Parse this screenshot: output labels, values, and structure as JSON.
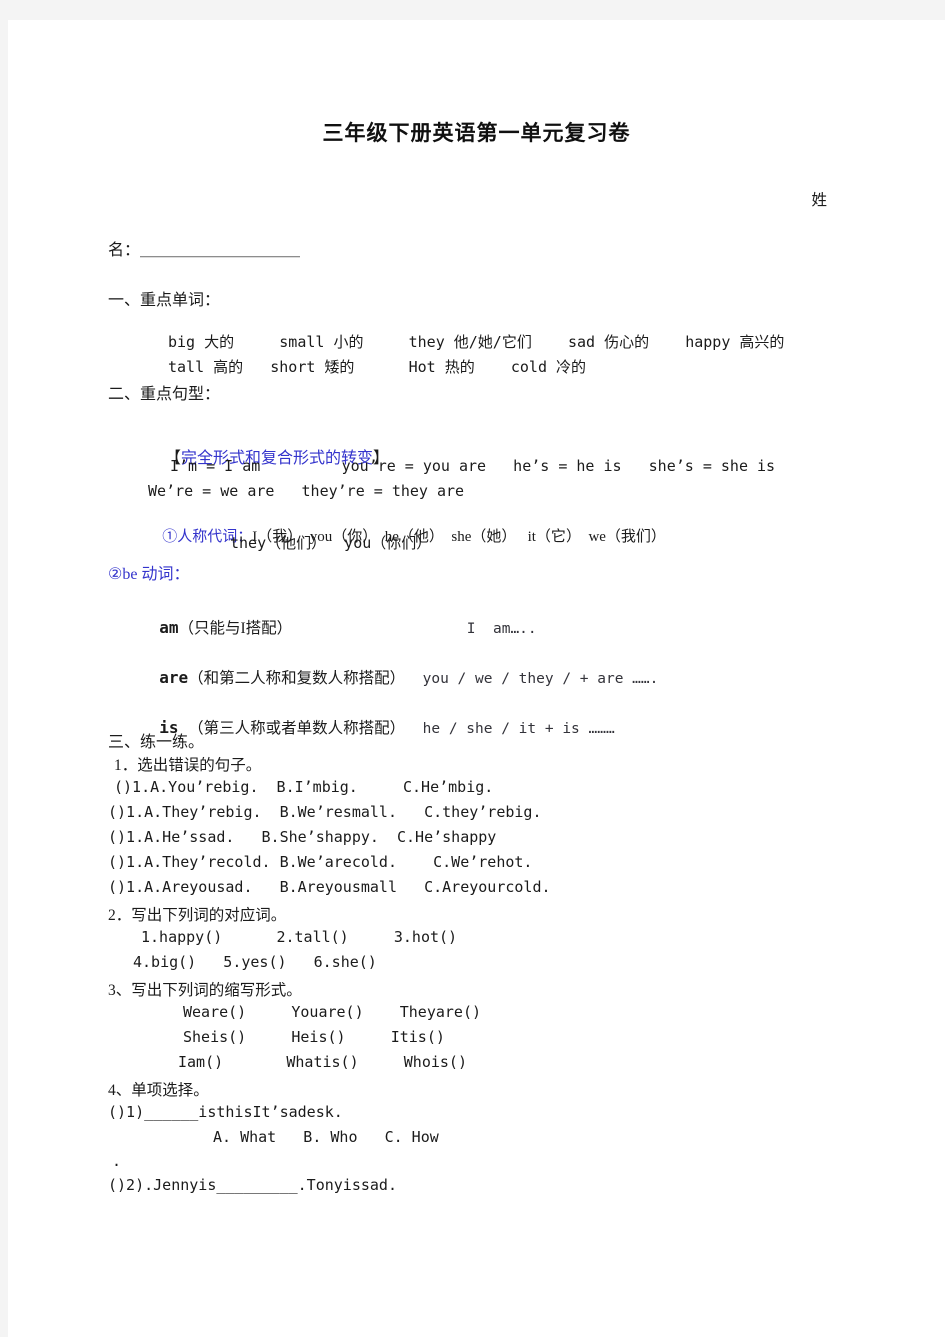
{
  "document": {
    "title": "三年级下册英语第一单元复习卷",
    "name_label_right": "姓",
    "name_label_line": "名：＿＿＿＿＿＿＿＿＿＿"
  },
  "section1": {
    "heading": "一、重点单词：",
    "row1": [
      {
        "en": "big ",
        "cn": "大的"
      },
      {
        "en": "small ",
        "cn": "小的"
      },
      {
        "en": "they ",
        "cn": "他/她/它们"
      },
      {
        "en": "sad ",
        "cn": "伤心的"
      },
      {
        "en": "happy ",
        "cn": "高兴的"
      }
    ],
    "row2": [
      {
        "en": "tall ",
        "cn": "高的"
      },
      {
        "en": "short ",
        "cn": "矮的"
      },
      {
        "en": "Hot ",
        "cn": "热的"
      },
      {
        "en": "cold ",
        "cn": "冷的"
      }
    ],
    "row1_text": "big 大的     small 小的     they 他/她/它们    sad 伤心的    happy 高兴的",
    "row2_text": "tall 高的   short 矮的      Hot 热的    cold 冷的"
  },
  "section2": {
    "heading": "二、重点句型：",
    "bracket_open": "【",
    "bracket_title": "完全形式和复合形式的转变",
    "bracket_close": "】",
    "contractions_line1": "I’m = I am         you’re = you are   he’s = he is   she’s = she is",
    "contractions_line2": "We’re = we are   they’re = they are",
    "item1_label": "①人称代词：",
    "item1_line1": "I（我）  you（你）  he（他）  she（她）   it（它）  we（我们）",
    "item1_line2": "they（他们）  you（你们）",
    "item2_label": "②be 动词：",
    "be_rows": [
      {
        "keyword": "am",
        "note": "（只能与I搭配）",
        "example": "I  am…..",
        "example_gap": "                    "
      },
      {
        "keyword": "are",
        "note": "（和第二人称和复数人称搭配）",
        "example": "you / we / they / + are …….",
        "example_gap": "  "
      },
      {
        "keyword": "is ",
        "note": "（第三人称或者单数人称搭配）",
        "example": "he / she / it + is ………",
        "example_gap": "  "
      }
    ]
  },
  "section3": {
    "heading": "三、练一练。",
    "q1_title": "1．选出错误的句子。",
    "q1_items": [
      "()1.A.You’rebig.  B.I’mbig.     C.He’mbig.",
      "()1.A.They’rebig.  B.We’resmall.   C.they’rebig.",
      "()1.A.He’ssad.   B.She’shappy.  C.He’shappy",
      "()1.A.They’recold. B.We’arecold.    C.We’rehot.",
      "()1.A.Areyousad.   B.Areyousmall   C.Areyourcold."
    ],
    "q2_title": "2．写出下列词的对应词。",
    "q2_line1": "1.happy()      2.tall()     3.hot()",
    "q2_line2": "4.big()   5.yes()   6.she()",
    "q3_title": "3、写出下列词的缩写形式。",
    "q3_line1": "Weare()     Youare()    Theyare()",
    "q3_line2": "Sheis()     Heis()     Itis()",
    "q3_line3": "Iam()       Whatis()     Whois()",
    "q4_title": "4、单项选择。",
    "q4_item1": "()1)______isthisIt’sadesk.",
    "q4_item1_options": "A. What   B. Who   C. How",
    "q4_stray": ".",
    "q4_item2": "()2).Jennyis_________.Tonyissad."
  },
  "colors": {
    "page_background": "#ffffff",
    "canvas_background": "#f4f4f4",
    "text": "#1b1b1b",
    "accent_blue": "#3333cc"
  }
}
